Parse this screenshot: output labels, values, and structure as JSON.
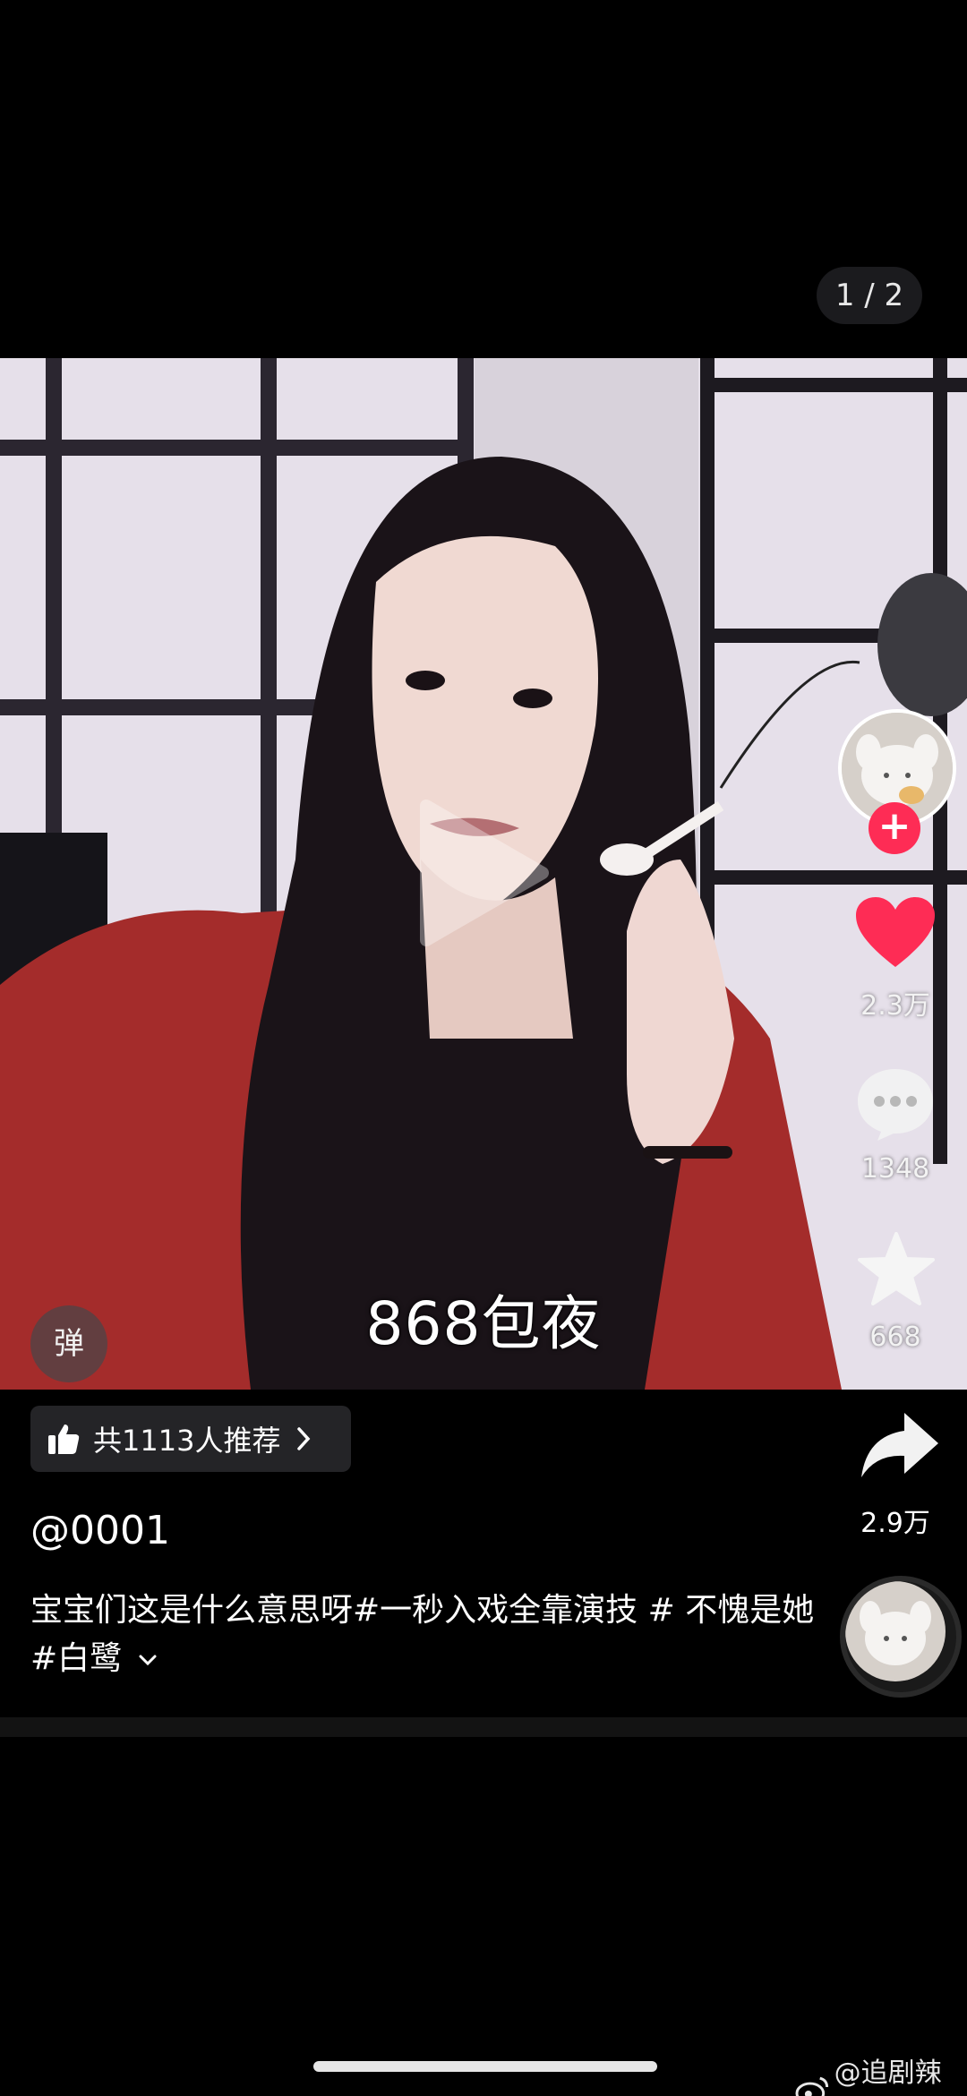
{
  "pager": {
    "text": "1 / 2"
  },
  "video": {
    "subtitle": "868包夜",
    "danmaku_label": "弹"
  },
  "right_rail": {
    "likes": "2.3万",
    "comments": "1348",
    "favorites": "668"
  },
  "recommend": {
    "label": "共1113人推荐"
  },
  "share": {
    "count": "2.9万"
  },
  "post": {
    "username": "@0001",
    "caption": "宝宝们这是什么意思呀#一秒入戏全靠演技 # 不愧是她 #白鹭"
  },
  "watermark": {
    "text": "@追剧辣妹"
  },
  "colors": {
    "accent_red": "#fe2c55",
    "background": "#000000",
    "chip_bg": "#242427"
  },
  "icons": {
    "play": "play-icon",
    "like": "heart-icon",
    "comment": "comment-bubble-icon",
    "favorite": "star-icon",
    "share": "share-arrow-icon",
    "recommend": "thumbs-up-icon",
    "follow": "plus-icon",
    "watermark": "weibo-icon"
  }
}
